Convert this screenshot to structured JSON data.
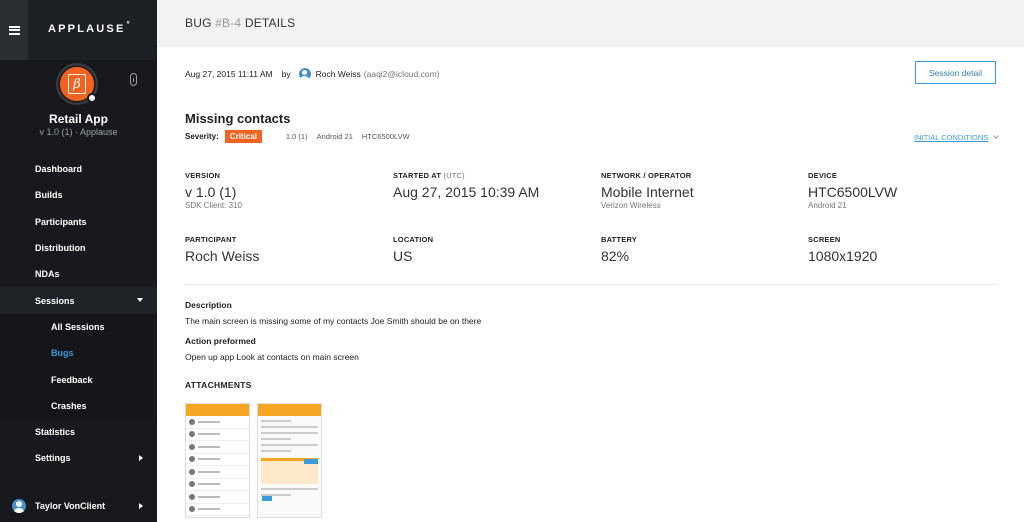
{
  "sidebar": {
    "brand": "APPLAUSE",
    "brand_mark": "°",
    "app_name": "Retail App",
    "app_version": "v 1.0 (1) · Applause",
    "items": [
      {
        "label": "Dashboard"
      },
      {
        "label": "Builds"
      },
      {
        "label": "Participants"
      },
      {
        "label": "Distribution"
      },
      {
        "label": "NDAs"
      },
      {
        "label": "Sessions"
      },
      {
        "label": "All Sessions"
      },
      {
        "label": "Bugs"
      },
      {
        "label": "Feedback"
      },
      {
        "label": "Crashes"
      },
      {
        "label": "Statistics"
      },
      {
        "label": "Settings"
      }
    ],
    "user_name": "Taylor VonClient"
  },
  "header": {
    "title_prefix": "BUG ",
    "title_id": "#B-4",
    "title_suffix": " DETAILS"
  },
  "meta": {
    "date": "Aug 27, 2015 11:11 AM",
    "by": "by",
    "author": "Roch Weiss",
    "email": "(aaqi2@icloud.com)"
  },
  "session_button": "Session detail",
  "bug": {
    "title": "Missing contacts",
    "severity_label": "Severity:",
    "severity": "Critical",
    "tags": [
      "1.0 (1)",
      "Android 21",
      "HTC6500LVW"
    ],
    "initial_conditions": "INITIAL CONDITIONS"
  },
  "details": {
    "version": {
      "label": "VERSION",
      "value": "v 1.0 (1)",
      "sub": "SDK Client: 310"
    },
    "started": {
      "label": "STARTED AT",
      "unit": "(UTC)",
      "value": "Aug 27, 2015 10:39 AM"
    },
    "network": {
      "label": "NETWORK / OPERATOR",
      "value": "Mobile Internet",
      "sub": "Verizon Wireless"
    },
    "device": {
      "label": "DEVICE",
      "value": "HTC6500LVW",
      "sub": "Android 21"
    },
    "participant": {
      "label": "PARTICIPANT",
      "value": "Roch Weiss"
    },
    "location": {
      "label": "LOCATION",
      "value": "US"
    },
    "battery": {
      "label": "BATTERY",
      "value": "82%"
    },
    "screen": {
      "label": "SCREEN",
      "value": "1080x1920"
    }
  },
  "description": {
    "title": "Description",
    "text": "The main screen is missing some of my contacts Joe Smith should be on there"
  },
  "action": {
    "title": "Action preformed",
    "text": "Open up app Look at contacts on main screen"
  },
  "attachments": {
    "title": "ATTACHMENTS"
  },
  "colors": {
    "accent": "#3b9ad9",
    "severity": "#f26322",
    "sidebar": "#17191c"
  }
}
